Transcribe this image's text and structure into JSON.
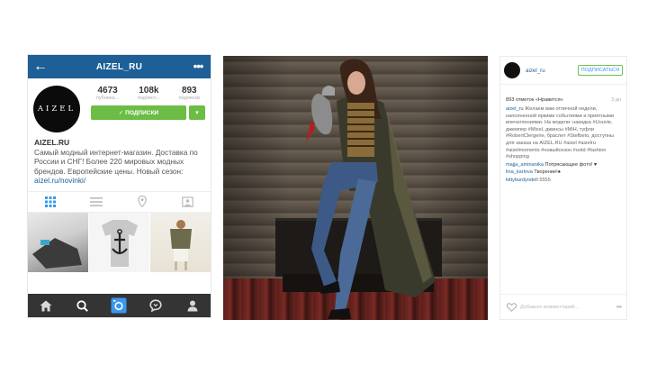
{
  "phone": {
    "title": "AIZEL_RU",
    "avatar_text": "AIZEL",
    "stats": [
      {
        "value": "4673",
        "label": "публика..."
      },
      {
        "value": "108k",
        "label": "подписч..."
      },
      {
        "value": "893",
        "label": "подписки"
      }
    ],
    "follow_label": "✓ ПОДПИСКИ",
    "bio_name": "AIZEL.RU",
    "bio_text": "Самый модный интернет-магазин. Доставка по России и СНГ! Более 220 мировых модных брендов. Европейские цены. Новый сезон:",
    "bio_link": "aizel.ru/novinki/",
    "icons": {
      "back": "arrow-left-icon",
      "more": "more-dots-icon",
      "grid": "grid-icon",
      "list": "list-icon",
      "location": "location-pin-icon",
      "tagged": "tagged-photo-icon",
      "home": "home-icon",
      "search": "search-icon",
      "camera": "camera-icon",
      "activity": "activity-bubble-icon",
      "profile": "profile-icon"
    }
  },
  "side": {
    "user": "aizel_ru",
    "subscribe_label": "ПОДПИСАТЬСЯ",
    "likes": "893 отметок «Нравится»",
    "time": "3 дн",
    "comments": [
      {
        "user": "aizel_ru",
        "text": "Желаем вам отличной недели, наполненной яркими событиями и приятными впечатлениями. На модели: накидка #Uouvie, джемпер #Mixel, джинсы #MiH, туфли #RobertClergerie, браслет #Stefbeto, доступны для заказа на AIZEL.RU #aizel #aizelru #aizelmoments #новыйсезон #ootd #fashion #shopping"
      },
      {
        "user": "majja_aminanika",
        "text": "Потрясающее фото! ♥"
      },
      {
        "user": "lina_karlova",
        "text": "Творение!♠"
      },
      {
        "user": "kittyburdyodell",
        "text": "5555"
      }
    ],
    "add_comment": "Добавьте комментарий...",
    "more": "•••"
  }
}
